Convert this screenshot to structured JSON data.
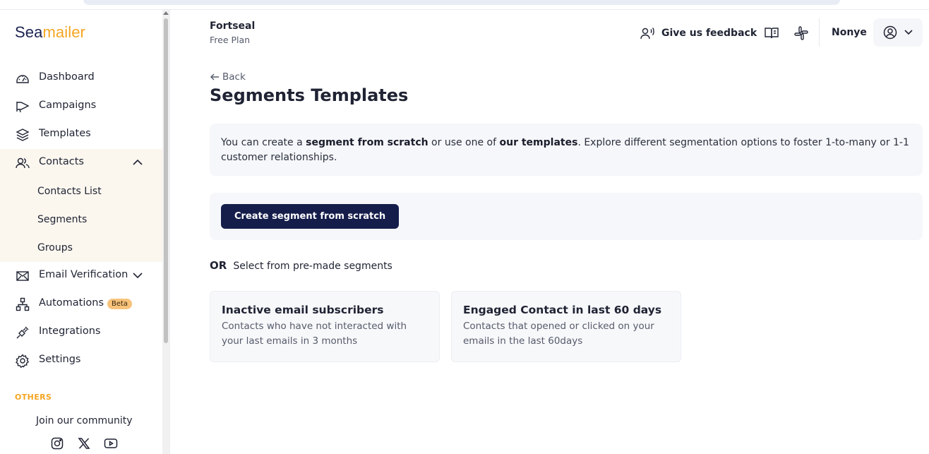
{
  "brand": {
    "part1": "Sea",
    "part2": "mailer",
    "accent": "#f5a623",
    "primary": "#1b2250"
  },
  "sidebar": {
    "items": [
      {
        "label": "Dashboard",
        "icon": "dashboard-gauge-icon"
      },
      {
        "label": "Campaigns",
        "icon": "megaphone-icon"
      },
      {
        "label": "Templates",
        "icon": "layers-icon"
      },
      {
        "label": "Contacts",
        "icon": "users-icon"
      },
      {
        "label": "Email Verification",
        "icon": "envelope-icon"
      },
      {
        "label": "Automations",
        "icon": "workflow-icon",
        "badge": "Beta"
      },
      {
        "label": "Integrations",
        "icon": "plug-icon"
      },
      {
        "label": "Settings",
        "icon": "gear-icon"
      }
    ],
    "contacts_sub": [
      "Contacts List",
      "Segments",
      "Groups"
    ],
    "others_label": "OTHERS",
    "community_label": "Join our community",
    "social": [
      "instagram-icon",
      "x-icon",
      "youtube-icon"
    ]
  },
  "header": {
    "org_name": "Fortseal",
    "plan": "Free Plan",
    "feedback_label": "Give us feedback",
    "user_name": "Nonye"
  },
  "main": {
    "back_label": "Back",
    "title": "Segments Templates",
    "info": {
      "t1": "You can create a ",
      "b1": "segment from scratch",
      "t2": " or use one of ",
      "b2": "our templates",
      "t3": ". Explore different segmentation options to foster 1-to-many or 1-1 customer relationships."
    },
    "create_button": "Create segment from scratch",
    "or_label": "OR",
    "select_label": "Select from pre-made segments",
    "cards": [
      {
        "title": "Inactive email subscribers",
        "desc": "Contacts who have not interacted with your last emails in 3 months"
      },
      {
        "title": "Engaged Contact in last 60 days",
        "desc": "Contacts that opened or clicked on your emails in the last 60days"
      }
    ]
  }
}
